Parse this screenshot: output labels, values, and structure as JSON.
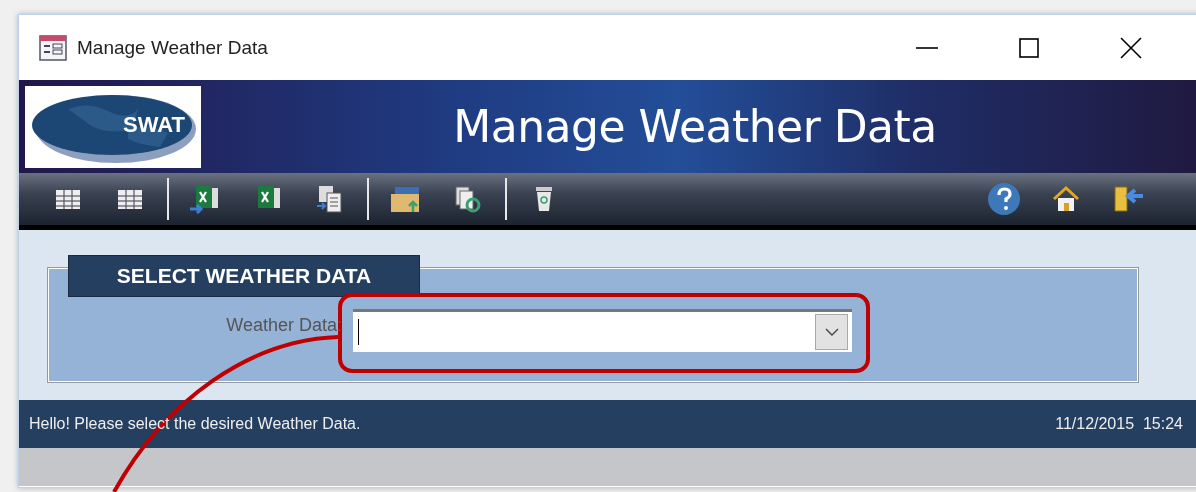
{
  "window": {
    "title": "Manage Weather Data"
  },
  "header": {
    "logo_text": "SWAT",
    "title": "Manage Weather Data"
  },
  "section": {
    "title": "SELECT WEATHER DATA",
    "field_label": "Weather Data:"
  },
  "status_bar": {
    "message": "Hello! Please select the desired Weather Data.",
    "datetime": "11/12/2015  15:24"
  }
}
